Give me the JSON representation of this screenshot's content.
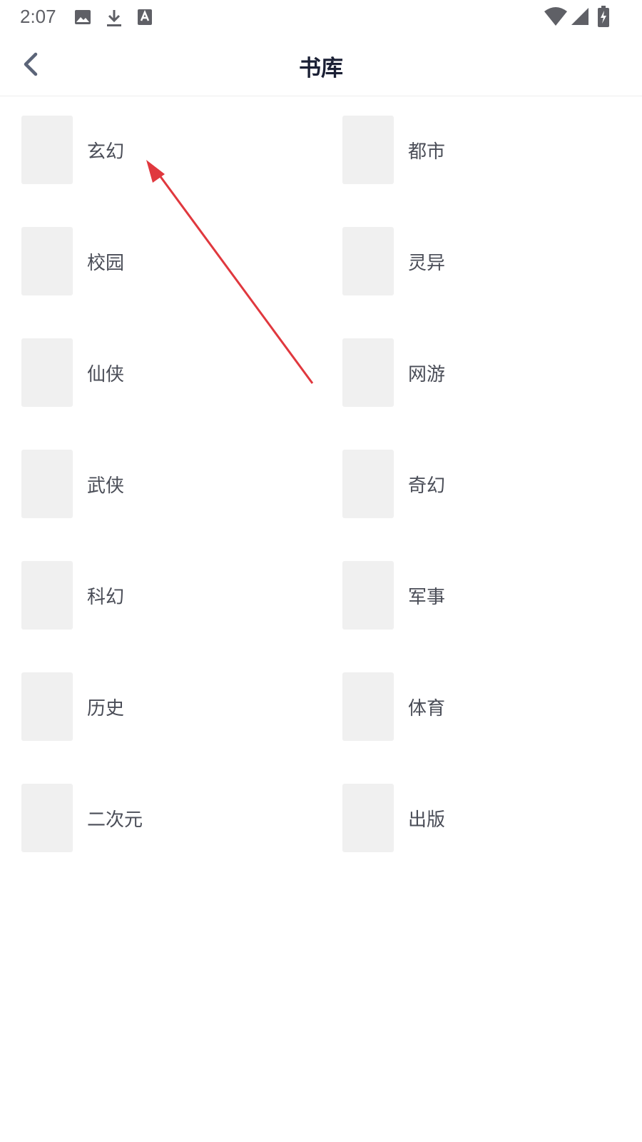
{
  "status_bar": {
    "time": "2:07",
    "left_icons": [
      "image-icon",
      "download-icon",
      "text-a-icon"
    ],
    "right_icons": [
      "wifi-icon",
      "signal-icon",
      "battery-icon"
    ]
  },
  "header": {
    "title": "书库",
    "back_icon": "chevron-left-icon"
  },
  "categories": [
    {
      "label": "玄幻"
    },
    {
      "label": "都市"
    },
    {
      "label": "校园"
    },
    {
      "label": "灵异"
    },
    {
      "label": "仙侠"
    },
    {
      "label": "网游"
    },
    {
      "label": "武侠"
    },
    {
      "label": "奇幻"
    },
    {
      "label": "科幻"
    },
    {
      "label": "军事"
    },
    {
      "label": "历史"
    },
    {
      "label": "体育"
    },
    {
      "label": "二次元"
    },
    {
      "label": "出版"
    }
  ],
  "colors": {
    "title": "#1b2035",
    "label": "#4a4d57",
    "cover_placeholder": "#f0f0f0",
    "annotation_arrow": "#e0383e"
  }
}
